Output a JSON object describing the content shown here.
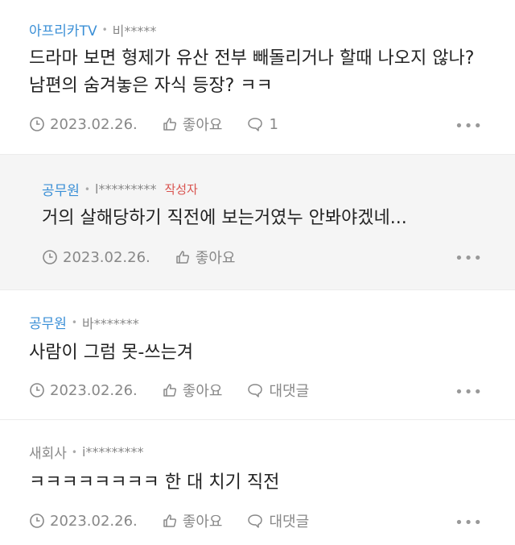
{
  "comments": [
    {
      "cafe": "아프리카TV",
      "user": "비*****",
      "text": "드라마 보면 형제가 유산 전부 빼돌리거나 할때 나오지 않나?\n남편의 숨겨놓은 자식 등장? ㅋㅋ",
      "date": "2023.02.26.",
      "like_label": "좋아요",
      "reply_label": "1"
    },
    {
      "cafe": "공무원",
      "user": "l*********",
      "author_badge": "작성자",
      "text": "거의 살해당하기 직전에 보는거였누 안봐야겠네...",
      "date": "2023.02.26.",
      "like_label": "좋아요"
    },
    {
      "cafe": "공무원",
      "user": "바*******",
      "text": "사람이 그럼 못-쓰는겨",
      "date": "2023.02.26.",
      "like_label": "좋아요",
      "reply_label": "대댓글"
    },
    {
      "cafe": "새회사",
      "user": "i*********",
      "text": "ㅋㅋㅋㅋㅋㅋㅋㅋ 한 대 치기 직전",
      "date": "2023.02.26.",
      "like_label": "좋아요",
      "reply_label": "대댓글"
    }
  ],
  "more_label": "•••",
  "colors": {
    "cafe_link": "#3a8fd6",
    "author_badge": "#d9534f",
    "reply_bg": "#f5f5f5"
  }
}
